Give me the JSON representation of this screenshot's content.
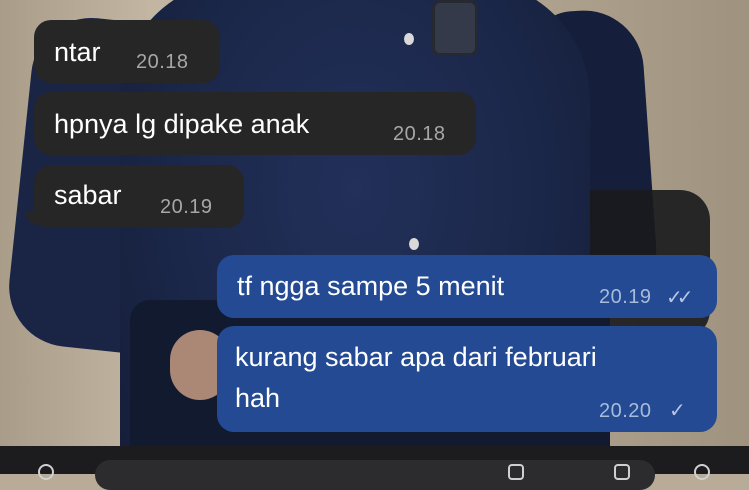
{
  "chat": {
    "messages": [
      {
        "direction": "in",
        "text": "ntar",
        "time": "20.18"
      },
      {
        "direction": "in",
        "text": "hpnya lg dipake anak",
        "time": "20.18"
      },
      {
        "direction": "in",
        "text": "sabar",
        "time": "20.19"
      },
      {
        "direction": "out",
        "text": "tf ngga sampe 5 menit",
        "time": "20.19",
        "status": "read",
        "status_glyph": "✓✓"
      },
      {
        "direction": "out",
        "text_line1": "kurang sabar apa dari februari",
        "text_line2": "hah",
        "time": "20.20",
        "status": "sent",
        "status_glyph": "✓"
      }
    ]
  },
  "colors": {
    "incoming_bubble": "#262626",
    "outgoing_bubble": "#234a92",
    "text": "#ffffff",
    "timestamp": "#a7a7a7"
  },
  "icons": [
    "attach-icon",
    "sticker-icon",
    "camera-icon",
    "mic-icon"
  ]
}
